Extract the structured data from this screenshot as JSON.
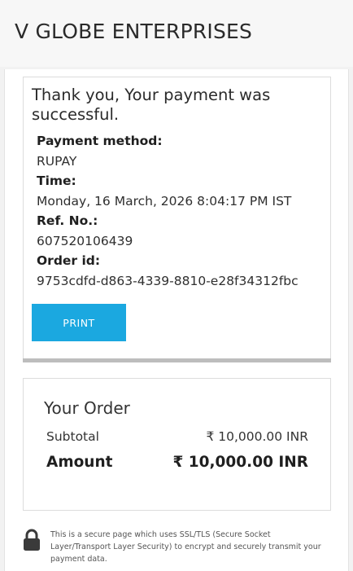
{
  "header": {
    "merchant_name": "V GLOBE ENTERPRISES"
  },
  "receipt": {
    "success_message": "Thank you, Your payment was successful.",
    "details": [
      {
        "label": "Payment method:",
        "value": "RUPAY"
      },
      {
        "label": "Time:",
        "value": "Monday, 16 March, 2026 8:04:17 PM IST"
      },
      {
        "label": "Ref. No.:",
        "value": "607520106439"
      },
      {
        "label": "Order id:",
        "value": "9753cdfd-d863-4339-8810-e28f34312fbc"
      }
    ],
    "print_label": "PRINT"
  },
  "order": {
    "title": "Your Order",
    "subtotal_label": "Subtotal",
    "subtotal_value": "₹ 10,000.00 INR",
    "amount_label": "Amount",
    "amount_value": "₹ 10,000.00 INR"
  },
  "footer": {
    "secure_notice": "This is a secure page which uses SSL/TLS (Secure Socket Layer/Transport Layer Security) to encrypt and securely transmit your payment data.",
    "icon": "lock-icon"
  },
  "colors": {
    "accent": "#1ba8e0",
    "background": "#f2f2f2"
  }
}
